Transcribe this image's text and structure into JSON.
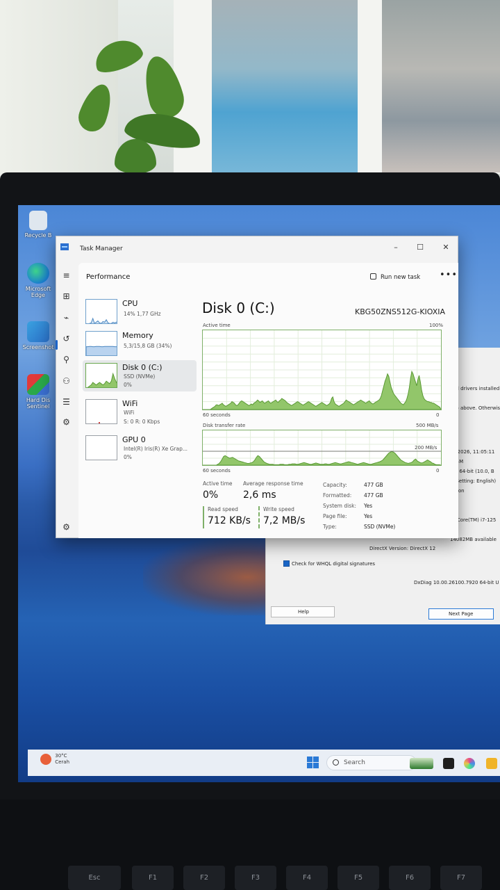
{
  "desktop": {
    "icons": [
      {
        "label": "Recycle B"
      },
      {
        "label": "Microsoft Edge"
      },
      {
        "label": "Screenshot"
      },
      {
        "label": "Hard Dis Sentinel"
      }
    ],
    "taskbar": {
      "weather_temp": "30°C",
      "weather_desc": "Cerah",
      "search_placeholder": "Search"
    }
  },
  "task_manager": {
    "title": "Task Manager",
    "section": "Performance",
    "run_new_task": "Run new task",
    "more": "•••",
    "resources": [
      {
        "name": "CPU",
        "sub1": "14%  1,77 GHz",
        "sub2": ""
      },
      {
        "name": "Memory",
        "sub1": "5,3/15,8 GB (34%)",
        "sub2": ""
      },
      {
        "name": "Disk 0 (C:)",
        "sub1": "SSD (NVMe)",
        "sub2": "0%"
      },
      {
        "name": "WiFi",
        "sub1": "WiFi",
        "sub2": "S: 0  R: 0 Kbps"
      },
      {
        "name": "GPU 0",
        "sub1": "Intel(R) Iris(R) Xe Grap...",
        "sub2": "0%"
      }
    ],
    "detail": {
      "title": "Disk 0 (C:)",
      "model": "KBG50ZNS512G-KIOXIA",
      "active_time_label": "Active time",
      "active_time_max": "100%",
      "seconds_label": "60 seconds",
      "zero": "0",
      "transfer_label": "Disk transfer rate",
      "transfer_max": "500 MB/s",
      "transfer_mark": "200 MB/s",
      "stats": {
        "active_time_label": "Active time",
        "active_time_value": "0%",
        "avg_response_label": "Average response time",
        "avg_response_value": "2,6 ms",
        "read_label": "Read speed",
        "read_value": "712 KB/s",
        "write_label": "Write speed",
        "write_value": "7,2 MB/s"
      },
      "properties": [
        {
          "key": "Capacity:",
          "value": "477 GB"
        },
        {
          "key": "Formatted:",
          "value": "477 GB"
        },
        {
          "key": "System disk:",
          "value": "Yes"
        },
        {
          "key": "Page file:",
          "value": "Yes"
        },
        {
          "key": "Type:",
          "value": "SSD (NVMe)"
        }
      ]
    },
    "active_time_series": [
      0,
      0,
      0,
      0,
      0,
      0,
      0,
      1,
      2,
      3,
      4,
      6,
      6,
      5,
      6,
      7,
      8,
      6,
      5,
      4,
      5,
      6,
      7,
      8,
      10,
      9,
      8,
      6,
      5,
      6,
      8,
      10,
      11,
      10,
      9,
      8,
      7,
      6,
      5,
      6,
      7,
      6,
      8,
      9,
      10,
      12,
      11,
      9,
      10,
      11,
      9,
      8,
      9,
      10,
      11,
      9,
      8,
      9,
      10,
      11,
      12,
      10,
      9,
      11,
      12,
      14,
      13,
      12,
      11,
      9,
      8,
      7,
      6,
      5,
      6,
      7,
      8,
      9,
      10,
      9,
      8,
      7,
      6,
      6,
      7,
      8,
      9,
      10,
      9,
      8,
      7,
      6,
      5,
      4,
      5,
      6,
      7,
      8,
      9,
      8,
      7,
      6,
      5,
      6,
      7,
      9,
      14,
      16,
      10,
      7,
      6,
      5,
      4,
      5,
      6,
      7,
      8,
      10,
      12,
      11,
      10,
      9,
      8,
      7,
      6,
      7,
      8,
      9,
      10,
      11,
      12,
      11,
      10,
      9,
      8,
      9,
      10,
      11,
      9,
      8,
      7,
      8,
      9,
      10,
      11,
      12,
      14,
      18,
      24,
      30,
      36,
      40,
      45,
      42,
      35,
      28,
      24,
      20,
      18,
      16,
      14,
      12,
      10,
      8,
      7,
      6,
      8,
      10,
      14,
      20,
      28,
      40,
      48,
      45,
      40,
      35,
      30,
      38,
      43,
      35,
      25,
      18,
      14,
      12,
      11,
      10,
      10,
      9,
      9,
      8,
      8,
      7,
      6,
      5,
      4,
      3,
      0
    ],
    "transfer_series": [
      0,
      0,
      0,
      0,
      0,
      0,
      0,
      0,
      0,
      0,
      2,
      4,
      8,
      14,
      20,
      22,
      20,
      18,
      16,
      17,
      18,
      16,
      14,
      12,
      10,
      9,
      8,
      7,
      6,
      5,
      4,
      4,
      5,
      6,
      8,
      12,
      18,
      22,
      20,
      16,
      12,
      8,
      6,
      4,
      3,
      2,
      2,
      2,
      1,
      1,
      1,
      1,
      2,
      2,
      2,
      1,
      1,
      1,
      2,
      2,
      3,
      3,
      3,
      2,
      2,
      3,
      4,
      5,
      6,
      5,
      4,
      3,
      2,
      2,
      3,
      4,
      5,
      4,
      3,
      2,
      2,
      2,
      3,
      3,
      2,
      2,
      3,
      4,
      5,
      6,
      5,
      4,
      3,
      3,
      4,
      5,
      6,
      7,
      8,
      7,
      6,
      5,
      4,
      3,
      2,
      3,
      4,
      5,
      6,
      5,
      4,
      3,
      2,
      2,
      3,
      4,
      5,
      6,
      7,
      8,
      10,
      12,
      16,
      20,
      24,
      28,
      30,
      32,
      30,
      28,
      24,
      20,
      16,
      12,
      10,
      8,
      6,
      5,
      4,
      5,
      6,
      8,
      12,
      14,
      10,
      8,
      6,
      5,
      6,
      8,
      10,
      12,
      10,
      8,
      5,
      4,
      2,
      1,
      1,
      1,
      0
    ],
    "mem_series": [
      40,
      40,
      41,
      41,
      40,
      40,
      41,
      41,
      41,
      40,
      40,
      41,
      41,
      41,
      41,
      41,
      41,
      40,
      40,
      40
    ],
    "cpu_series": [
      2,
      1,
      2,
      3,
      10,
      2,
      4,
      6,
      3,
      2,
      5,
      4,
      8,
      3,
      2,
      2,
      4,
      3,
      4,
      6
    ],
    "gpu_series": [
      0,
      0,
      0,
      0,
      0,
      0,
      0,
      0,
      0,
      0
    ],
    "disk_thumb_series": [
      0,
      1,
      2,
      3,
      5,
      4,
      3,
      4,
      5,
      4,
      3,
      4,
      6,
      5,
      4,
      6,
      12,
      8,
      5,
      3
    ]
  },
  "dxdiag": {
    "lines": [
      "nd drivers installed",
      "ab above. Otherwis",
      "ay 2026, 11:05:11",
      "9P4M",
      "me 64-bit (10.0, B",
      "al Setting: English)",
      "ration",
      "5",
      "R) Core(TM) i7-125",
      "14082MB available",
      "DirectX Version:  DirectX 12",
      "DxDiag 10.00.26100.7920 64-bit U"
    ],
    "whql_label": "Check for WHQL digital signatures",
    "help_button": "Help",
    "next_button": "Next Page"
  },
  "keyboard": {
    "keys": [
      "Esc",
      "F1",
      "F2",
      "F3",
      "F4",
      "F5",
      "F6",
      "F7"
    ]
  },
  "colors": {
    "graph_fill": "#92c66a",
    "graph_stroke": "#5b9a36",
    "accent": "#1c64c8"
  }
}
